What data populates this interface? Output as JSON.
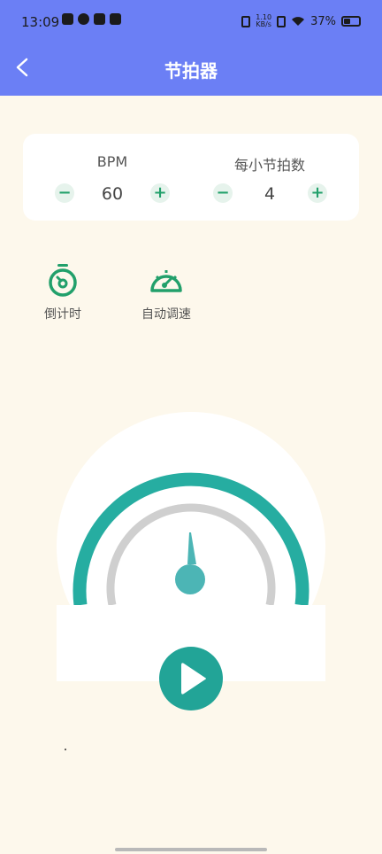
{
  "status_bar": {
    "time": "13:09",
    "net_speed_value": "1.10",
    "net_speed_unit": "KB/s",
    "battery_percent": "37%"
  },
  "app_bar": {
    "title": "节拍器",
    "back_icon": "chevron-left-icon"
  },
  "settings": {
    "bpm": {
      "label": "BPM",
      "value": "60"
    },
    "beats_per_bar": {
      "label": "每小节拍数",
      "value": "4"
    }
  },
  "tools": [
    {
      "label": "倒计时",
      "icon": "stopwatch-icon"
    },
    {
      "label": "自动调速",
      "icon": "speedometer-icon"
    }
  ],
  "colors": {
    "app_bar": "#6b7ff5",
    "background": "#fdf8ec",
    "accent_green": "#22a06b",
    "dial_teal": "#26ada1",
    "dial_gray": "#cfcfcf",
    "needle": "#4cb5b5"
  },
  "play_icon": "play-icon"
}
